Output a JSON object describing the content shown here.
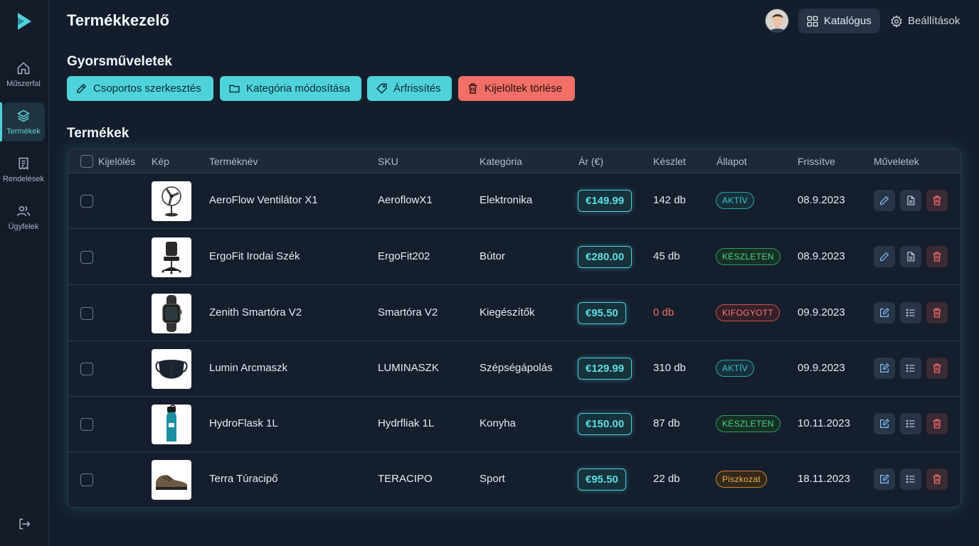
{
  "sidebar": {
    "items": [
      {
        "label": "Műszerfal",
        "icon": "home-icon"
      },
      {
        "label": "Termékek",
        "icon": "layers-icon",
        "active": true
      },
      {
        "label": "Rendelések",
        "icon": "receipt-icon"
      },
      {
        "label": "Ügyfelek",
        "icon": "users-icon"
      }
    ],
    "logout_icon": "logout-icon"
  },
  "header": {
    "title": "Termékkezelő",
    "catalog_label": "Katalógus",
    "settings_label": "Beállítások"
  },
  "quick_actions": {
    "title": "Gyorsműveletek",
    "buttons": [
      {
        "label": "Csoportos szerkesztés",
        "icon": "pencil-icon"
      },
      {
        "label": "Kategória módosítása",
        "icon": "folder-icon"
      },
      {
        "label": "Árfrissítés",
        "icon": "tag-icon"
      },
      {
        "label": "Kijelöltek törlése",
        "icon": "trash-icon"
      }
    ]
  },
  "products": {
    "title": "Termékek",
    "columns": [
      "Kijelölés",
      "Kép",
      "Terméknév",
      "SKU",
      "Kategória",
      "Ár (€)",
      "Készlet",
      "Állapot",
      "Frissítve",
      "Műveletek"
    ],
    "rows": [
      {
        "name": "AeroFlow Ventilátor X1",
        "sku": "AeroflowX1",
        "category": "Elektronika",
        "price": "€149.99",
        "stock": "142 db",
        "status": "AKTÍV",
        "updated": "08.9.2023",
        "image": "fan"
      },
      {
        "name": "ErgoFit Irodai Szék",
        "sku": "ErgoFit202",
        "category": "Bútor",
        "price": "€280.00",
        "stock": "45 db",
        "status": "KÉSZLETEN",
        "updated": "08.9.2023",
        "image": "chair"
      },
      {
        "name": "Zenith Smartóra V2",
        "sku": "Smartóra V2",
        "category": "Kiegészítők",
        "price": "€95.50",
        "stock": "0 db",
        "status": "KIFOGYOTT",
        "updated": "09.9.2023",
        "image": "watch"
      },
      {
        "name": "Lumin Arcmaszk",
        "sku": "LUMINASZK",
        "category": "Szépségápolás",
        "price": "€129.99",
        "stock": "310 db",
        "status": "AKTÍV",
        "updated": "09.9.2023",
        "image": "mask"
      },
      {
        "name": "HydroFlask 1L",
        "sku": "Hydrfliak 1L",
        "category": "Konyha",
        "price": "€150.00",
        "stock": "87 db",
        "status": "KÉSZLETEN",
        "updated": "10.11.2023",
        "image": "bottle"
      },
      {
        "name": "Terra Túracipő",
        "sku": "TERACIPO",
        "category": "Sport",
        "price": "€95.50",
        "stock": "22 db",
        "status": "Piszkozat",
        "updated": "18.11.2023",
        "image": "shoe"
      }
    ]
  },
  "colors": {
    "accent": "#4fd3da",
    "danger": "#f16f67",
    "active_badge": "#3cc7c9",
    "instock_badge": "#3dbb6b",
    "out_badge": "#e0605a",
    "draft_badge": "#e8a33a"
  }
}
